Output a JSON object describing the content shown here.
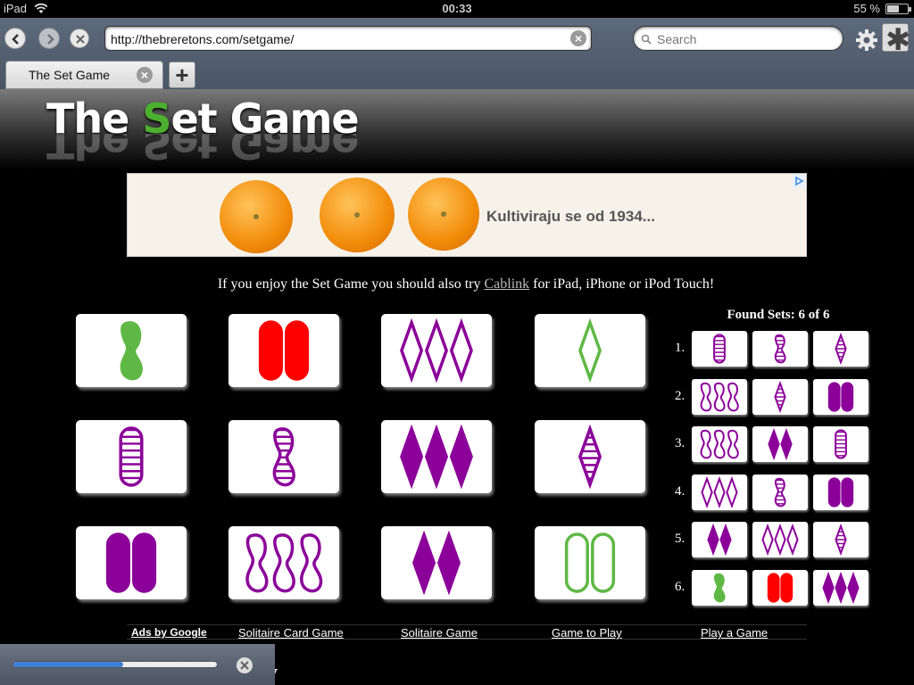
{
  "status_bar": {
    "device": "iPad",
    "time": "00:33",
    "battery_text": "55 %",
    "battery_level": 0.55
  },
  "browser": {
    "url": "http://thebreretons.com/setgame/",
    "search_placeholder": "Search",
    "tab_title": "The Set Game",
    "new_tab_label": "+",
    "load_progress": 0.54
  },
  "page": {
    "logo": {
      "pre": "The ",
      "accent": "S",
      "post": "et Game"
    },
    "ad": {
      "text": "Kultiviraju se od 1934...",
      "colors": {
        "orange": "#f28c0a"
      }
    },
    "promo": {
      "before": "If you enjoy the Set Game you should also try ",
      "link": "Cablink",
      "after": " for iPad, iPhone or iPod Touch!"
    },
    "found_sets_title": "Found Sets: 6 of 6",
    "footer": {
      "ads_label": "Ads by Google",
      "links": [
        "Solitaire Card Game",
        "Solitaire Game",
        "Game to Play",
        "Play a Game"
      ]
    },
    "partial_text": "y"
  },
  "colors": {
    "green": "#5fb845",
    "red": "#ff0000",
    "purple": "#8b0099"
  },
  "board": [
    {
      "count": 1,
      "shape": "squiggle",
      "fill": "solid",
      "color": "green"
    },
    {
      "count": 2,
      "shape": "oval",
      "fill": "solid",
      "color": "red"
    },
    {
      "count": 3,
      "shape": "diamond",
      "fill": "open",
      "color": "purple"
    },
    {
      "count": 1,
      "shape": "diamond",
      "fill": "open",
      "color": "green"
    },
    {
      "count": 1,
      "shape": "oval",
      "fill": "striped",
      "color": "purple"
    },
    {
      "count": 1,
      "shape": "squiggle",
      "fill": "striped",
      "color": "purple"
    },
    {
      "count": 3,
      "shape": "diamond",
      "fill": "solid",
      "color": "purple"
    },
    {
      "count": 1,
      "shape": "diamond",
      "fill": "striped",
      "color": "purple"
    },
    {
      "count": 2,
      "shape": "oval",
      "fill": "solid",
      "color": "purple"
    },
    {
      "count": 3,
      "shape": "squiggle",
      "fill": "open",
      "color": "purple"
    },
    {
      "count": 2,
      "shape": "diamond",
      "fill": "solid",
      "color": "purple"
    },
    {
      "count": 2,
      "shape": "oval",
      "fill": "open",
      "color": "green"
    }
  ],
  "found_sets": [
    {
      "label": "1.",
      "cards": [
        {
          "count": 1,
          "shape": "oval",
          "fill": "striped",
          "color": "purple"
        },
        {
          "count": 1,
          "shape": "squiggle",
          "fill": "striped",
          "color": "purple"
        },
        {
          "count": 1,
          "shape": "diamond",
          "fill": "striped",
          "color": "purple"
        }
      ]
    },
    {
      "label": "2.",
      "cards": [
        {
          "count": 3,
          "shape": "squiggle",
          "fill": "open",
          "color": "purple"
        },
        {
          "count": 1,
          "shape": "diamond",
          "fill": "striped",
          "color": "purple"
        },
        {
          "count": 2,
          "shape": "oval",
          "fill": "solid",
          "color": "purple"
        }
      ]
    },
    {
      "label": "3.",
      "cards": [
        {
          "count": 3,
          "shape": "squiggle",
          "fill": "open",
          "color": "purple"
        },
        {
          "count": 2,
          "shape": "diamond",
          "fill": "solid",
          "color": "purple"
        },
        {
          "count": 1,
          "shape": "oval",
          "fill": "striped",
          "color": "purple"
        }
      ]
    },
    {
      "label": "4.",
      "cards": [
        {
          "count": 3,
          "shape": "diamond",
          "fill": "open",
          "color": "purple"
        },
        {
          "count": 1,
          "shape": "squiggle",
          "fill": "striped",
          "color": "purple"
        },
        {
          "count": 2,
          "shape": "oval",
          "fill": "solid",
          "color": "purple"
        }
      ]
    },
    {
      "label": "5.",
      "cards": [
        {
          "count": 2,
          "shape": "diamond",
          "fill": "solid",
          "color": "purple"
        },
        {
          "count": 3,
          "shape": "diamond",
          "fill": "open",
          "color": "purple"
        },
        {
          "count": 1,
          "shape": "diamond",
          "fill": "striped",
          "color": "purple"
        }
      ]
    },
    {
      "label": "6.",
      "cards": [
        {
          "count": 1,
          "shape": "squiggle",
          "fill": "solid",
          "color": "green"
        },
        {
          "count": 2,
          "shape": "oval",
          "fill": "solid",
          "color": "red"
        },
        {
          "count": 3,
          "shape": "diamond",
          "fill": "solid",
          "color": "purple"
        }
      ]
    }
  ]
}
